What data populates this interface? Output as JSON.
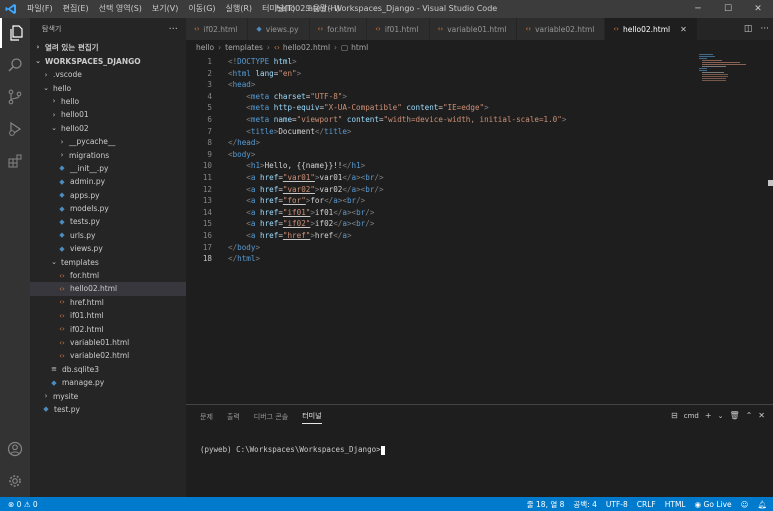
{
  "window": {
    "title": "hello02.html - Workspaces_Django - Visual Studio Code",
    "menu": [
      "파일(F)",
      "편집(E)",
      "선택 영역(S)",
      "보기(V)",
      "이동(G)",
      "실행(R)",
      "터미널(T)",
      "도움말(H)"
    ]
  },
  "sidebar": {
    "title": "탐색기",
    "open_editors": "열려 있는 편집기",
    "workspace": "WORKSPACES_DJANGO",
    "tree": [
      {
        "label": ".vscode",
        "indent": 1,
        "kind": "folder-closed"
      },
      {
        "label": "hello",
        "indent": 1,
        "kind": "folder-open"
      },
      {
        "label": "hello",
        "indent": 2,
        "kind": "folder-closed"
      },
      {
        "label": "hello01",
        "indent": 2,
        "kind": "folder-closed"
      },
      {
        "label": "hello02",
        "indent": 2,
        "kind": "folder-open"
      },
      {
        "label": "__pycache__",
        "indent": 3,
        "kind": "folder-closed"
      },
      {
        "label": "migrations",
        "indent": 3,
        "kind": "folder-closed"
      },
      {
        "label": "__init__.py",
        "indent": 3,
        "kind": "py"
      },
      {
        "label": "admin.py",
        "indent": 3,
        "kind": "py"
      },
      {
        "label": "apps.py",
        "indent": 3,
        "kind": "py"
      },
      {
        "label": "models.py",
        "indent": 3,
        "kind": "py"
      },
      {
        "label": "tests.py",
        "indent": 3,
        "kind": "py"
      },
      {
        "label": "urls.py",
        "indent": 3,
        "kind": "py"
      },
      {
        "label": "views.py",
        "indent": 3,
        "kind": "py"
      },
      {
        "label": "templates",
        "indent": 2,
        "kind": "folder-open"
      },
      {
        "label": "for.html",
        "indent": 3,
        "kind": "html"
      },
      {
        "label": "hello02.html",
        "indent": 3,
        "kind": "html",
        "selected": true
      },
      {
        "label": "href.html",
        "indent": 3,
        "kind": "html"
      },
      {
        "label": "if01.html",
        "indent": 3,
        "kind": "html"
      },
      {
        "label": "if02.html",
        "indent": 3,
        "kind": "html"
      },
      {
        "label": "variable01.html",
        "indent": 3,
        "kind": "html"
      },
      {
        "label": "variable02.html",
        "indent": 3,
        "kind": "html"
      },
      {
        "label": "db.sqlite3",
        "indent": 2,
        "kind": "db"
      },
      {
        "label": "manage.py",
        "indent": 2,
        "kind": "py"
      },
      {
        "label": "mysite",
        "indent": 1,
        "kind": "folder-closed"
      },
      {
        "label": "test.py",
        "indent": 1,
        "kind": "py"
      }
    ]
  },
  "tabs": [
    {
      "label": "if02.html",
      "kind": "html"
    },
    {
      "label": "views.py",
      "kind": "py"
    },
    {
      "label": "for.html",
      "kind": "html"
    },
    {
      "label": "if01.html",
      "kind": "html"
    },
    {
      "label": "variable01.html",
      "kind": "html"
    },
    {
      "label": "variable02.html",
      "kind": "html"
    },
    {
      "label": "hello02.html",
      "kind": "html",
      "active": true
    }
  ],
  "breadcrumbs": [
    "hello",
    "templates",
    "hello02.html",
    "html"
  ],
  "editor": {
    "current_line": 18,
    "lines": [
      [
        [
          "p",
          "<!"
        ],
        [
          "t",
          "DOCTYPE"
        ],
        [
          "x",
          " "
        ],
        [
          "a",
          "html"
        ],
        [
          "p",
          ">"
        ]
      ],
      [
        [
          "p",
          "<"
        ],
        [
          "t",
          "html"
        ],
        [
          "x",
          " "
        ],
        [
          "a",
          "lang"
        ],
        [
          "x",
          "="
        ],
        [
          "s",
          "\"en\""
        ],
        [
          "p",
          ">"
        ]
      ],
      [
        [
          "p",
          "<"
        ],
        [
          "t",
          "head"
        ],
        [
          "p",
          ">"
        ]
      ],
      [
        [
          "x",
          "    "
        ],
        [
          "p",
          "<"
        ],
        [
          "t",
          "meta"
        ],
        [
          "x",
          " "
        ],
        [
          "a",
          "charset"
        ],
        [
          "x",
          "="
        ],
        [
          "s",
          "\"UTF-8\""
        ],
        [
          "p",
          ">"
        ]
      ],
      [
        [
          "x",
          "    "
        ],
        [
          "p",
          "<"
        ],
        [
          "t",
          "meta"
        ],
        [
          "x",
          " "
        ],
        [
          "a",
          "http-equiv"
        ],
        [
          "x",
          "="
        ],
        [
          "s",
          "\"X-UA-Compatible\""
        ],
        [
          "x",
          " "
        ],
        [
          "a",
          "content"
        ],
        [
          "x",
          "="
        ],
        [
          "s",
          "\"IE=edge\""
        ],
        [
          "p",
          ">"
        ]
      ],
      [
        [
          "x",
          "    "
        ],
        [
          "p",
          "<"
        ],
        [
          "t",
          "meta"
        ],
        [
          "x",
          " "
        ],
        [
          "a",
          "name"
        ],
        [
          "x",
          "="
        ],
        [
          "s",
          "\"viewport\""
        ],
        [
          "x",
          " "
        ],
        [
          "a",
          "content"
        ],
        [
          "x",
          "="
        ],
        [
          "s",
          "\"width=device-width, initial-scale=1.0\""
        ],
        [
          "p",
          ">"
        ]
      ],
      [
        [
          "x",
          "    "
        ],
        [
          "p",
          "<"
        ],
        [
          "t",
          "title"
        ],
        [
          "p",
          ">"
        ],
        [
          "x",
          "Document"
        ],
        [
          "p",
          "</"
        ],
        [
          "t",
          "title"
        ],
        [
          "p",
          ">"
        ]
      ],
      [
        [
          "p",
          "</"
        ],
        [
          "t",
          "head"
        ],
        [
          "p",
          ">"
        ]
      ],
      [
        [
          "p",
          "<"
        ],
        [
          "t",
          "body"
        ],
        [
          "p",
          ">"
        ]
      ],
      [
        [
          "x",
          "    "
        ],
        [
          "p",
          "<"
        ],
        [
          "t",
          "h1"
        ],
        [
          "p",
          ">"
        ],
        [
          "x",
          "Hello, {{name}}!!"
        ],
        [
          "p",
          "</"
        ],
        [
          "t",
          "h1"
        ],
        [
          "p",
          ">"
        ]
      ],
      [
        [
          "x",
          "    "
        ],
        [
          "p",
          "<"
        ],
        [
          "t",
          "a"
        ],
        [
          "x",
          " "
        ],
        [
          "a",
          "href"
        ],
        [
          "x",
          "="
        ],
        [
          "s",
          "\"var01\""
        ],
        [
          "p",
          ">"
        ],
        [
          "x",
          "var01"
        ],
        [
          "p",
          "</"
        ],
        [
          "t",
          "a"
        ],
        [
          "p",
          "><"
        ],
        [
          "t",
          "br"
        ],
        [
          "p",
          "/>"
        ]
      ],
      [
        [
          "x",
          "    "
        ],
        [
          "p",
          "<"
        ],
        [
          "t",
          "a"
        ],
        [
          "x",
          " "
        ],
        [
          "a",
          "href"
        ],
        [
          "x",
          "="
        ],
        [
          "s",
          "\"var02\""
        ],
        [
          "p",
          ">"
        ],
        [
          "x",
          "var02"
        ],
        [
          "p",
          "</"
        ],
        [
          "t",
          "a"
        ],
        [
          "p",
          "><"
        ],
        [
          "t",
          "br"
        ],
        [
          "p",
          "/>"
        ]
      ],
      [
        [
          "x",
          "    "
        ],
        [
          "p",
          "<"
        ],
        [
          "t",
          "a"
        ],
        [
          "x",
          " "
        ],
        [
          "a",
          "href"
        ],
        [
          "x",
          "="
        ],
        [
          "s",
          "\"for\""
        ],
        [
          "p",
          ">"
        ],
        [
          "x",
          "for"
        ],
        [
          "p",
          "</"
        ],
        [
          "t",
          "a"
        ],
        [
          "p",
          "><"
        ],
        [
          "t",
          "br"
        ],
        [
          "p",
          "/>"
        ]
      ],
      [
        [
          "x",
          "    "
        ],
        [
          "p",
          "<"
        ],
        [
          "t",
          "a"
        ],
        [
          "x",
          " "
        ],
        [
          "a",
          "href"
        ],
        [
          "x",
          "="
        ],
        [
          "s",
          "\"if01\""
        ],
        [
          "p",
          ">"
        ],
        [
          "x",
          "if01"
        ],
        [
          "p",
          "</"
        ],
        [
          "t",
          "a"
        ],
        [
          "p",
          "><"
        ],
        [
          "t",
          "br"
        ],
        [
          "p",
          "/>"
        ]
      ],
      [
        [
          "x",
          "    "
        ],
        [
          "p",
          "<"
        ],
        [
          "t",
          "a"
        ],
        [
          "x",
          " "
        ],
        [
          "a",
          "href"
        ],
        [
          "x",
          "="
        ],
        [
          "s",
          "\"if02\""
        ],
        [
          "p",
          ">"
        ],
        [
          "x",
          "if02"
        ],
        [
          "p",
          "</"
        ],
        [
          "t",
          "a"
        ],
        [
          "p",
          "><"
        ],
        [
          "t",
          "br"
        ],
        [
          "p",
          "/>"
        ]
      ],
      [
        [
          "x",
          "    "
        ],
        [
          "p",
          "<"
        ],
        [
          "t",
          "a"
        ],
        [
          "x",
          " "
        ],
        [
          "a",
          "href"
        ],
        [
          "x",
          "="
        ],
        [
          "s",
          "\"href\""
        ],
        [
          "p",
          ">"
        ],
        [
          "x",
          "href"
        ],
        [
          "p",
          "</"
        ],
        [
          "t",
          "a"
        ],
        [
          "p",
          ">"
        ]
      ],
      [
        [
          "p",
          "</"
        ],
        [
          "t",
          "body"
        ],
        [
          "p",
          ">"
        ]
      ],
      [
        [
          "p",
          "</"
        ],
        [
          "t",
          "html"
        ],
        [
          "p",
          ">"
        ]
      ]
    ]
  },
  "panel": {
    "tabs": [
      "문제",
      "출력",
      "디버그 콘솔",
      "터미널"
    ],
    "active_tab": "터미널",
    "shell": "cmd",
    "prompt": "(pyweb) C:\\Workspaces\\Workspaces_Django>"
  },
  "status": {
    "problems": "⊗ 0 ⚠ 0",
    "position": "줄 18, 열 8",
    "spaces": "공백: 4",
    "encoding": "UTF-8",
    "eol": "CRLF",
    "language": "HTML",
    "golive": "Go Live"
  },
  "colors": {
    "accent": "#007acc",
    "html_icon": "#e37933",
    "py_icon": "#4b8bbe",
    "tag": "#569cd6",
    "attr": "#9cdcfe",
    "string": "#ce9178"
  }
}
